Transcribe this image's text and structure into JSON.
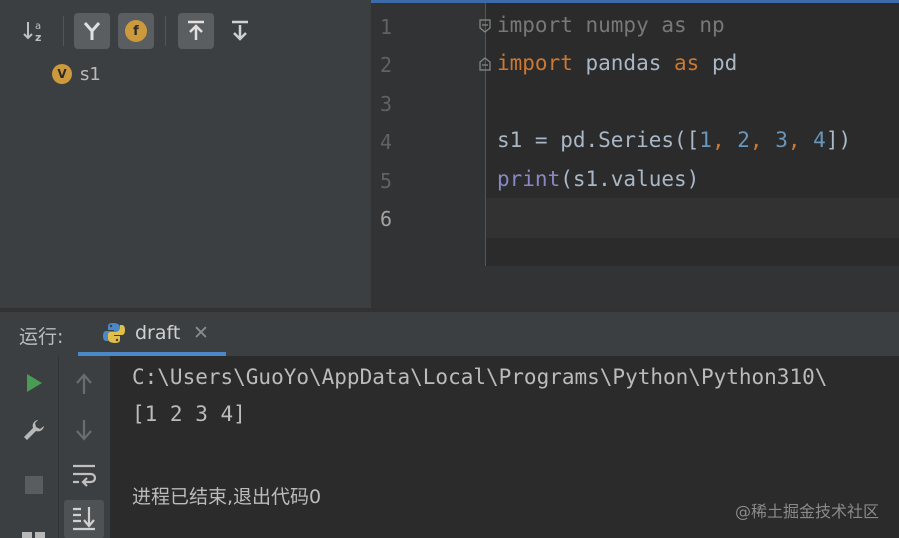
{
  "structure": {
    "toolbar": {
      "sort_alpha_icon": "sort-alphabetically-icon",
      "show_inherited_icon": "branch-icon",
      "show_fields_badge": "f",
      "expand_icon": "expand-all-icon",
      "collapse_icon": "collapse-all-icon"
    },
    "items": [
      {
        "badge": "V",
        "label": "s1"
      }
    ]
  },
  "editor": {
    "line_numbers": [
      "1",
      "2",
      "3",
      "4",
      "5",
      "6"
    ],
    "lines": [
      {
        "kw1": "import",
        "mod": " numpy ",
        "kw2": "as",
        "alias": " np"
      },
      {
        "kw1": "import",
        "mod": " pandas ",
        "kw2": "as",
        "alias": " pd"
      },
      {
        "text": ""
      },
      {
        "pre": "s1 = pd.Series([",
        "n1": "1",
        "c1": ", ",
        "n2": "2",
        "c2": ", ",
        "n3": "3",
        "c3": ", ",
        "n4": "4",
        "post": "])"
      },
      {
        "fn": "print",
        "rest": "(s1.values)"
      },
      {
        "text": ""
      }
    ]
  },
  "run": {
    "label": "运行:",
    "tab_name": "draft",
    "tab_close": "✕",
    "output": [
      "C:\\Users\\GuoYo\\AppData\\Local\\Programs\\Python\\Python310\\",
      "[1 2 3 4]",
      "",
      "进程已结束,退出代码0"
    ],
    "watermark": "@稀土掘金技术社区"
  },
  "colors": {
    "keyword": "#cc7832",
    "number": "#6897bb",
    "builtin": "#8888c6",
    "text": "#a9b7c6",
    "run_green": "#499c54",
    "accent": "#4a88c7"
  }
}
